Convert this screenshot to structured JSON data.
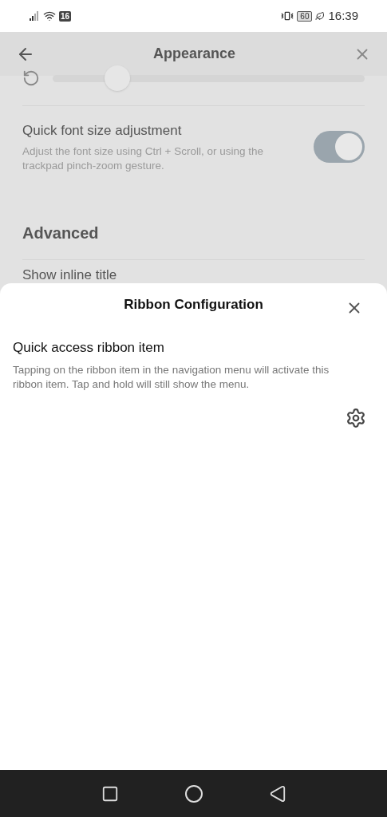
{
  "status_bar": {
    "badge": "16",
    "battery": "60",
    "time": "16:39"
  },
  "header": {
    "title": "Appearance"
  },
  "background": {
    "slider": {
      "level": 0.18
    },
    "settings": [
      {
        "label": "Quick font size adjustment",
        "description": "Adjust the font size using Ctrl + Scroll, or using the trackpad pinch-zoom gesture.",
        "on": true
      }
    ],
    "section": "Advanced",
    "next_item": "Show inline title"
  },
  "sheet": {
    "title": "Ribbon Configuration",
    "setting": {
      "label": "Quick access ribbon item",
      "description": "Tapping on the ribbon item in the navigation menu will activate this ribbon item. Tap and hold will still show the menu."
    }
  }
}
